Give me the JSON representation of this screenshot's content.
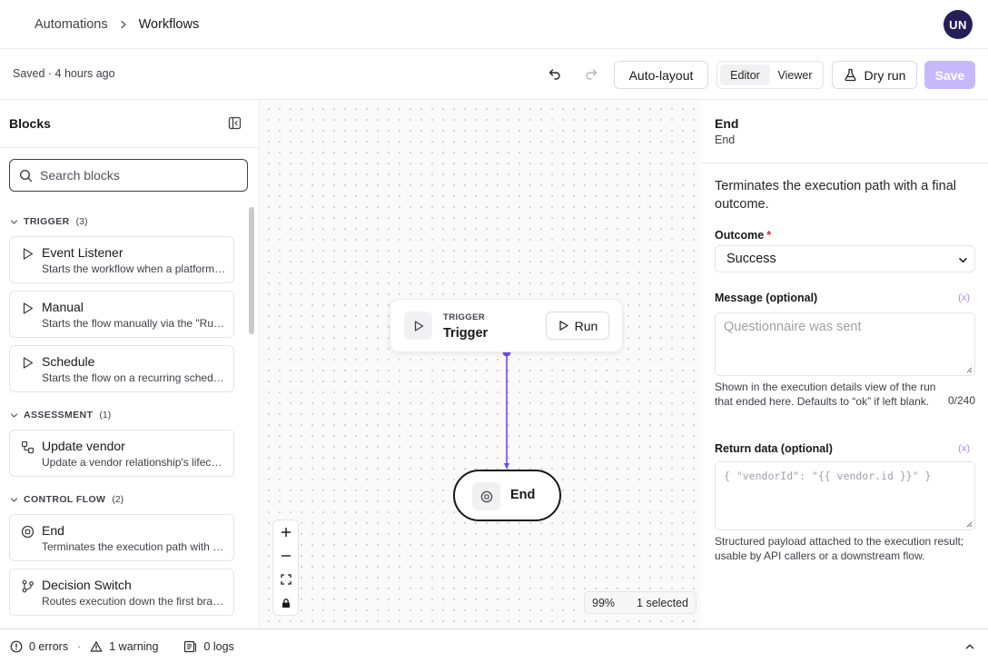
{
  "breadcrumb": {
    "parent": "Automations",
    "current": "Workflows"
  },
  "user": {
    "initials": "UN"
  },
  "toolbar": {
    "saved_status": "Saved · 4 hours ago",
    "auto_layout": "Auto-layout",
    "mode_editor": "Editor",
    "mode_viewer": "Viewer",
    "dry_run": "Dry run",
    "save": "Save"
  },
  "blocks": {
    "title": "Blocks",
    "search_placeholder": "Search blocks",
    "groups": [
      {
        "name": "TRIGGER",
        "count": "(3)"
      },
      {
        "name": "ASSESSMENT",
        "count": "(1)"
      },
      {
        "name": "CONTROL FLOW",
        "count": "(2)"
      }
    ],
    "items": [
      {
        "title": "Event Listener",
        "desc": "Starts the workflow when a platform event occurs",
        "icon": "play-icon"
      },
      {
        "title": "Manual",
        "desc": "Starts the flow manually via the \"Run\" button",
        "icon": "play-icon"
      },
      {
        "title": "Schedule",
        "desc": "Starts the flow on a recurring schedule",
        "icon": "play-icon"
      },
      {
        "title": "Update vendor",
        "desc": "Update a vendor relationship's lifecycle",
        "icon": "workflow-icon"
      },
      {
        "title": "End",
        "desc": "Terminates the execution path with a final outcome",
        "icon": "stop-circle-icon"
      },
      {
        "title": "Decision Switch",
        "desc": "Routes execution down the first branch that matches",
        "icon": "branch-icon"
      }
    ]
  },
  "canvas": {
    "trigger_node": {
      "kicker": "TRIGGER",
      "name": "Trigger",
      "run_label": "Run"
    },
    "end_node": {
      "name": "End"
    },
    "zoom": "99%",
    "selection": "1 selected"
  },
  "inspector": {
    "title": "End",
    "subtitle": "End",
    "description": "Terminates the execution path with a final outcome.",
    "outcome_label": "Outcome",
    "outcome_required": "*",
    "outcome_value": "Success",
    "message_label": "Message (optional)",
    "message_placeholder": "Questionnaire was sent",
    "message_help": "Shown in the execution details view of the run that ended here. Defaults to “ok” if left blank.",
    "message_counter": "0/240",
    "return_label": "Return data (optional)",
    "return_placeholder": "{ \"vendorId\": \"{{ vendor.id }}\" }",
    "return_help": "Structured payload attached to the execution result; usable by API callers or a downstream flow.",
    "variable_token": "(x)"
  },
  "status_bar": {
    "errors": "0 errors",
    "warnings": "1 warning",
    "logs": "0 logs"
  },
  "colors": {
    "accent": "#6d4aef",
    "save_disabled": "#c7b8fb",
    "avatar": "#241f57"
  }
}
